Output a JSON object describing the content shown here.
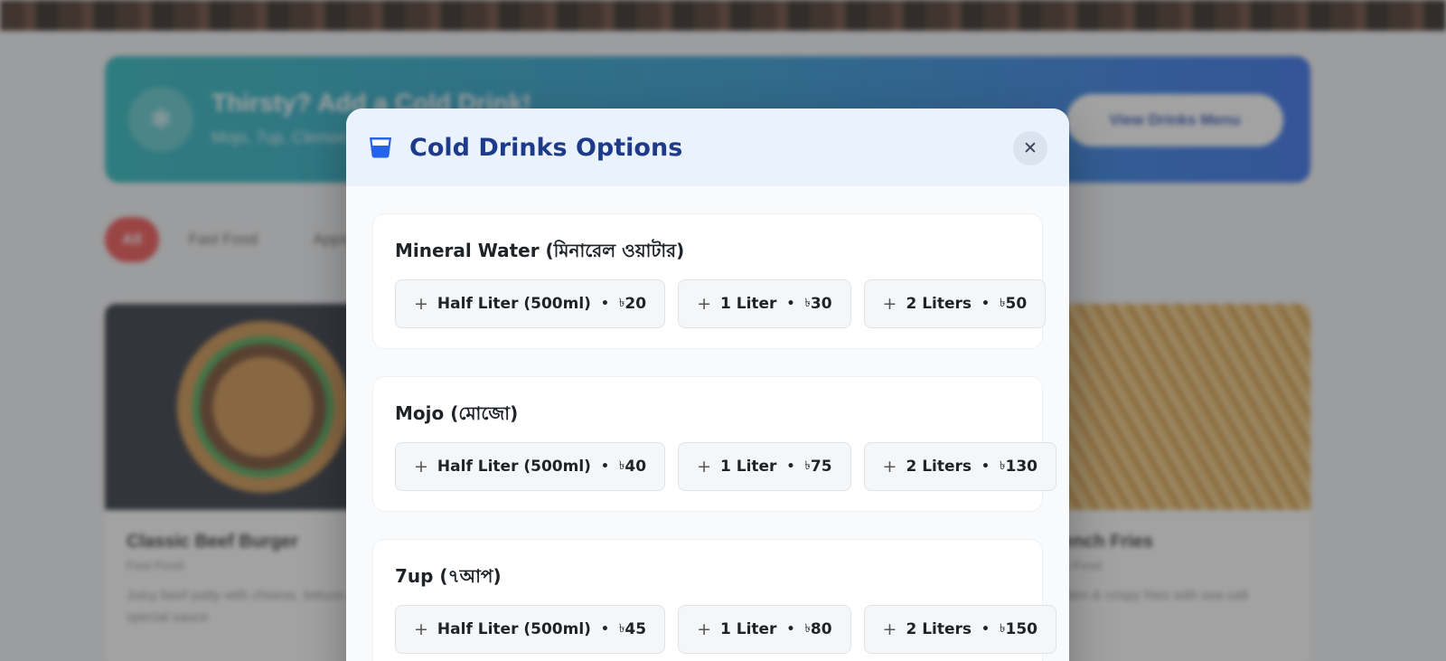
{
  "background": {
    "banner": {
      "title": "Thirsty? Add a Cold Drink!",
      "subtitle": "Mojo, 7up, Clemon & more",
      "button_label": "View Drinks Menu"
    },
    "categories": [
      "All",
      "Fast Food",
      "Apps"
    ],
    "cards": [
      {
        "title": "Classic Beef Burger",
        "category": "Fast Food",
        "description": "Juicy beef patty with cheese, lettuce & special sauce"
      },
      {
        "title": "French Fries",
        "category": "Fast Food",
        "description": "Golden & crispy fries with sea salt"
      }
    ]
  },
  "modal": {
    "title": "Cold Drinks Options",
    "close_symbol": "✕",
    "icon": "cup-icon",
    "accent_color": "#1e3a8a",
    "drinks": [
      {
        "name": "Mineral Water (মিনারেল ওয়াটার)",
        "options": [
          {
            "label": "Half Liter (500ml)",
            "currency": "৳",
            "price": "20"
          },
          {
            "label": "1 Liter",
            "currency": "৳",
            "price": "30"
          },
          {
            "label": "2 Liters",
            "currency": "৳",
            "price": "50"
          }
        ]
      },
      {
        "name": "Mojo (মোজো)",
        "options": [
          {
            "label": "Half Liter (500ml)",
            "currency": "৳",
            "price": "40"
          },
          {
            "label": "1 Liter",
            "currency": "৳",
            "price": "75"
          },
          {
            "label": "2 Liters",
            "currency": "৳",
            "price": "130"
          }
        ]
      },
      {
        "name": "7up (৭আপ)",
        "options": [
          {
            "label": "Half Liter (500ml)",
            "currency": "৳",
            "price": "45"
          },
          {
            "label": "1 Liter",
            "currency": "৳",
            "price": "80"
          },
          {
            "label": "2 Liters",
            "currency": "৳",
            "price": "150"
          }
        ]
      }
    ]
  }
}
